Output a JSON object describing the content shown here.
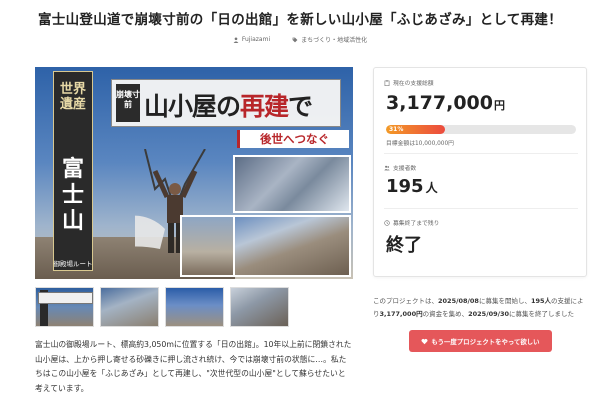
{
  "project": {
    "title": "富士山登山道で崩壊寸前の「日の出館」を新しい山小屋「ふじあざみ」として再建！",
    "owner": "Fujiazami",
    "category": "まちづくり・地域活性化"
  },
  "hero": {
    "vertical_top": "世界遺産",
    "vertical_main": "富士山",
    "vertical_bottom": "御殿場ルート",
    "banner_sub": "崩壊寸前",
    "banner_main_a": "山小屋の",
    "banner_main_accent": "再建",
    "banner_main_b": "で",
    "future_label": "後世へつなぐ"
  },
  "description": "富士山の御殿場ルート、標高約3,050mに位置する「日の出館」。10年以上前に閉鎖された山小屋は、上から押し寄せる砂礫きに押し流され続け、今では崩壊寸前の状態に…。私たちはこの山小屋を「ふじあざみ」として再建し、\"次世代型の山小屋\"として蘇らせたいと考えています。",
  "stats": {
    "raised_label": "現在の支援総額",
    "raised_amount": "3,177,000",
    "currency_unit": "円",
    "progress_percent": 31,
    "progress_text": "31%",
    "goal_text": "目標金額は10,000,000円",
    "supporters_label": "支援者数",
    "supporters_count": "195",
    "supporters_unit": "人",
    "remaining_label": "募集終了まで残り",
    "remaining_value": "終了"
  },
  "summary": {
    "prefix": "このプロジェクトは、",
    "start_date": "2025/08/08",
    "mid1": "に募集を開始し、",
    "supporters": "195人",
    "mid2": "の支援により",
    "amount": "3,177,000円",
    "mid3": "の資金を集め、",
    "end_date": "2025/09/30",
    "suffix": "に募集を終了しました"
  },
  "cta": {
    "label": "もう一度プロジェクトをやって欲しい"
  },
  "colors": {
    "accent": "#e5575a",
    "progress_start": "#f39a26",
    "progress_end": "#ec4b3e",
    "banner_red": "#b8262a"
  },
  "icons": {
    "owner": "user-icon",
    "category": "tag-icon",
    "raised": "clipboard-icon",
    "supporters": "people-icon",
    "remaining": "clock-icon",
    "cta": "heart-icon"
  }
}
